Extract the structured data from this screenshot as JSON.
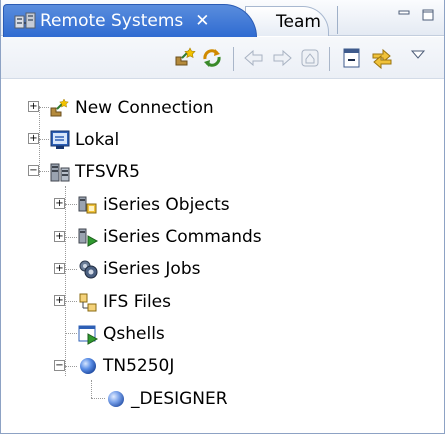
{
  "tabs": {
    "active_label": "Remote Systems",
    "close_glyph": "✕",
    "other_label": "Team"
  },
  "icons": {
    "tab": "remote-systems-icon",
    "new_connection": "new-connection-icon",
    "refresh": "refresh-icon",
    "back": "back-arrow-icon",
    "forward": "forward-arrow-icon",
    "home": "home-icon",
    "collapse_all": "collapse-all-icon",
    "link_with_editor": "link-with-editor-icon",
    "view_menu": "view-menu-icon"
  },
  "tree": {
    "items": [
      {
        "label": "New Connection",
        "toggle": "+"
      },
      {
        "label": "Lokal",
        "toggle": "+"
      },
      {
        "label": "TFSVR5",
        "toggle": "−"
      },
      {
        "label": "iSeries Objects",
        "toggle": "+"
      },
      {
        "label": "iSeries Commands",
        "toggle": "+"
      },
      {
        "label": "iSeries Jobs",
        "toggle": "+"
      },
      {
        "label": "IFS Files",
        "toggle": "+"
      },
      {
        "label": "Qshells",
        "toggle": ""
      },
      {
        "label": "TN5250J",
        "toggle": "−"
      },
      {
        "label": "_DESIGNER",
        "toggle": ""
      }
    ]
  },
  "colors": {
    "active_tab": "#3a74d6",
    "border": "#8da2c4"
  }
}
